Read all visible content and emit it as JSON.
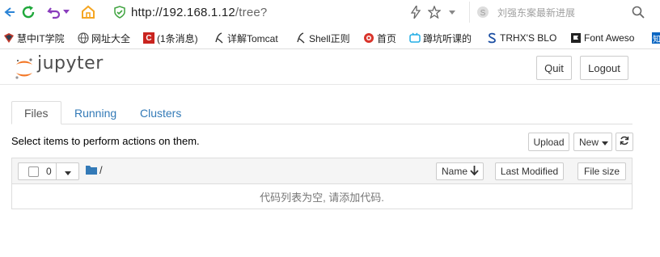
{
  "browser": {
    "url_host": "http://192.168.1.12",
    "url_path": "/tree?",
    "search_placeholder": "刘强东案最新进展"
  },
  "bookmarks": [
    {
      "label": "慧中IT学院",
      "icon": "brand-icon"
    },
    {
      "label": "网址大全",
      "icon": "globe-icon"
    },
    {
      "label": "(1条消息)",
      "icon": "csdn-icon"
    },
    {
      "label": "详解Tomcat",
      "icon": "script-icon"
    },
    {
      "label": "Shell正则",
      "icon": "script-icon"
    },
    {
      "label": "首页",
      "icon": "brand-icon"
    },
    {
      "label": "蹲坑听课的",
      "icon": "tv-icon"
    },
    {
      "label": "TRHX'S BLO",
      "icon": "s-icon"
    },
    {
      "label": "Font Aweso",
      "icon": "flag-icon"
    },
    {
      "label": "知",
      "icon": "zhihu-icon"
    }
  ],
  "jupyter": {
    "logo_text": "jupyter",
    "quit_label": "Quit",
    "logout_label": "Logout"
  },
  "tabs": [
    {
      "label": "Files",
      "active": true
    },
    {
      "label": "Running",
      "active": false
    },
    {
      "label": "Clusters",
      "active": false
    }
  ],
  "instructions": "Select items to perform actions on them.",
  "actions": {
    "upload_label": "Upload",
    "new_label": "New",
    "refresh_icon": "refresh-icon"
  },
  "file_list": {
    "selected_count": "0",
    "breadcrumb": "/",
    "col_name": "Name",
    "col_modified": "Last Modified",
    "col_size": "File size",
    "empty_message": "代码列表为空, 请添加代码."
  },
  "colors": {
    "link_blue": "#337ab7",
    "folder_blue": "#337ab7",
    "jupyter_orange": "#f37726",
    "nav_green": "#1fa83b",
    "nav_purple": "#8a3dbd",
    "home_orange": "#f5a623"
  }
}
